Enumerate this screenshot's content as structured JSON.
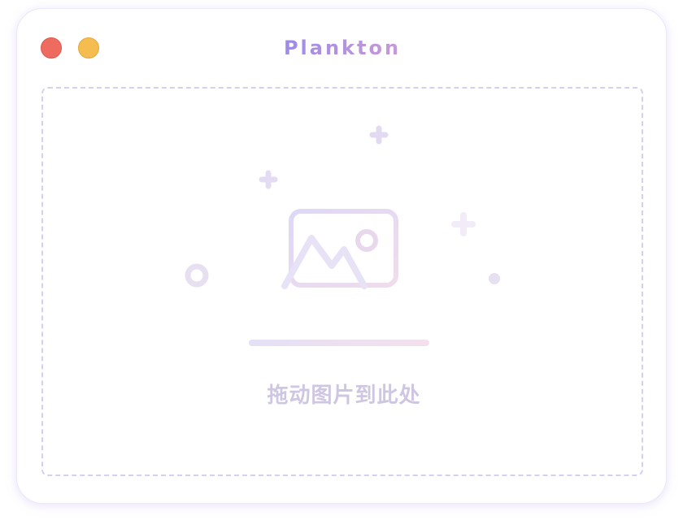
{
  "window": {
    "title": "Plankton"
  },
  "controls": {
    "close_color": "#ee6b5f",
    "minimize_color": "#f5bd4f"
  },
  "dropzone": {
    "label": "拖动图片到此处",
    "icon": "image-placeholder-icon"
  },
  "colors": {
    "accent_start": "#9d8be9",
    "accent_end": "#c89ad6",
    "dashed_border": "#d4d0f0",
    "label": "#cfc7e1"
  }
}
